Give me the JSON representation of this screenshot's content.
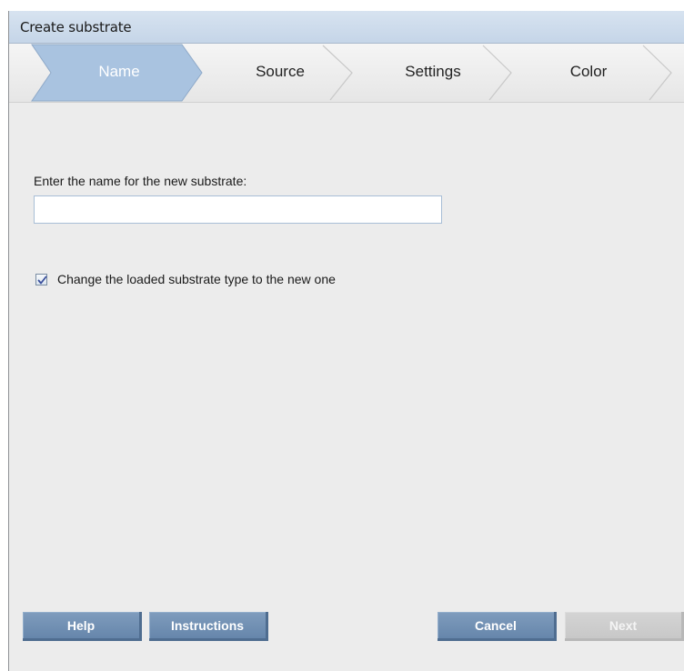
{
  "window": {
    "title": "Create substrate"
  },
  "wizard": {
    "steps": [
      {
        "label": "Name",
        "active": true
      },
      {
        "label": "Source",
        "active": false
      },
      {
        "label": "Settings",
        "active": false
      },
      {
        "label": "Color",
        "active": false
      }
    ]
  },
  "form": {
    "name_label": "Enter the name for the new substrate:",
    "name_value": "",
    "checkbox_label": "Change the loaded substrate type to the new one",
    "checkbox_checked": true
  },
  "buttons": {
    "help": "Help",
    "instructions": "Instructions",
    "cancel": "Cancel",
    "next": "Next"
  },
  "colors": {
    "active_step": "#a9c3e0",
    "button_fill": "#7592b4",
    "button_disabled": "#cfcfcf",
    "titlebar": "#c9d8ea"
  }
}
